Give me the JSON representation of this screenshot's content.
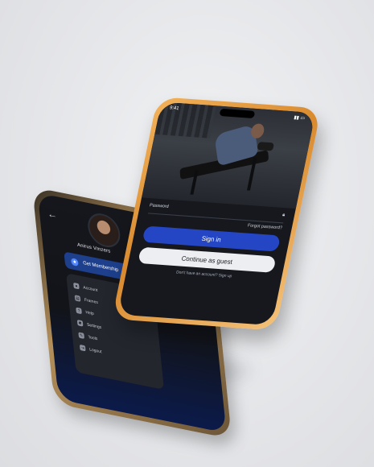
{
  "back_phone": {
    "user_name": "Anirus Vmzers",
    "membership_label": "Get Membership",
    "membership_icon": "member-icon",
    "menu": [
      {
        "label": "Account",
        "icon": "user-icon"
      },
      {
        "label": "Frames",
        "icon": "frames-icon"
      },
      {
        "label": "Help",
        "icon": "help-icon"
      },
      {
        "label": "Settings",
        "icon": "gear-icon"
      },
      {
        "label": "Tools",
        "icon": "tools-icon"
      },
      {
        "label": "Logout",
        "icon": "logout-icon"
      }
    ]
  },
  "front_phone": {
    "status_time": "9:41",
    "password_label": "Password",
    "forgot_label": "Forgot password?",
    "signin_label": "Sign in",
    "guest_label": "Continue as guest",
    "signup_text": "Don't have an account? Sign up"
  },
  "colors": {
    "accent": "#2446c4",
    "frame_gold": "#e4a146",
    "frame_bronze": "#8a6d47"
  }
}
